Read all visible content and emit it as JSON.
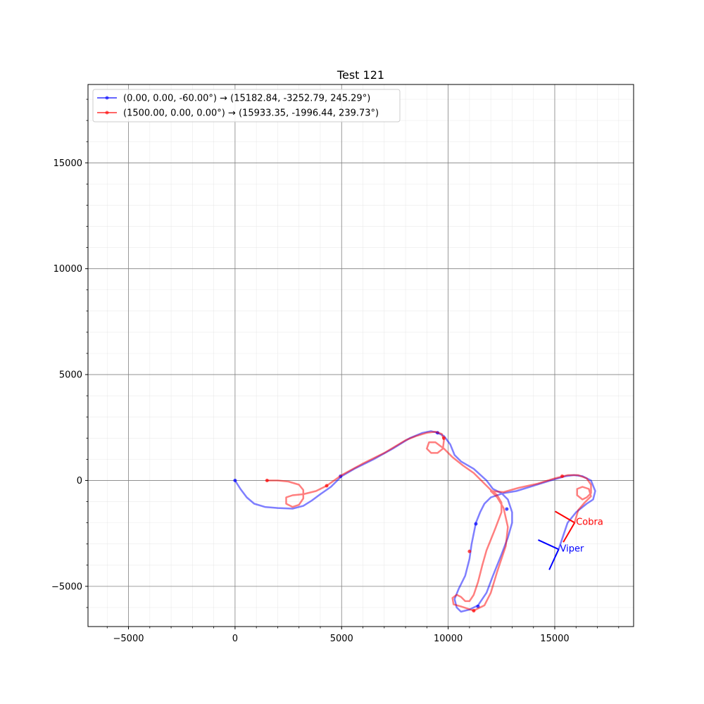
{
  "chart_data": {
    "type": "line",
    "title": "Test 121",
    "xlim": [
      -6900,
      18700
    ],
    "ylim": [
      -6900,
      18700
    ],
    "xticks": [
      -5000,
      0,
      5000,
      10000,
      15000
    ],
    "yticks": [
      -5000,
      0,
      5000,
      10000,
      15000
    ],
    "tick_labels": [
      "−5000",
      "0",
      "5000",
      "10000",
      "15000"
    ],
    "grid": true,
    "legend_placement": "top-left",
    "series": [
      {
        "name": "(0.00, 0.00, -60.00°) → (15182.84, -3252.79, 245.29°)",
        "color": "#0000ff",
        "points": [
          [
            0,
            0
          ],
          [
            250,
            -400
          ],
          [
            550,
            -800
          ],
          [
            900,
            -1100
          ],
          [
            1400,
            -1250
          ],
          [
            2000,
            -1300
          ],
          [
            2700,
            -1330
          ],
          [
            3200,
            -1200
          ],
          [
            3600,
            -950
          ],
          [
            4000,
            -650
          ],
          [
            4500,
            -300
          ],
          [
            5000,
            200
          ],
          [
            5600,
            550
          ],
          [
            6500,
            1000
          ],
          [
            7400,
            1500
          ],
          [
            8200,
            2000
          ],
          [
            8800,
            2250
          ],
          [
            9200,
            2330
          ],
          [
            9500,
            2250
          ],
          [
            9800,
            2100
          ],
          [
            10100,
            1700
          ],
          [
            10300,
            1200
          ],
          [
            10600,
            900
          ],
          [
            11200,
            550
          ],
          [
            11800,
            0
          ],
          [
            12100,
            -400
          ],
          [
            12500,
            -600
          ],
          [
            12800,
            -900
          ],
          [
            13000,
            -1500
          ],
          [
            13000,
            -2000
          ],
          [
            12800,
            -2700
          ],
          [
            12500,
            -3500
          ],
          [
            12100,
            -4500
          ],
          [
            11800,
            -5300
          ],
          [
            11400,
            -5900
          ],
          [
            11000,
            -6100
          ],
          [
            10600,
            -6200
          ],
          [
            10400,
            -6000
          ],
          [
            10300,
            -5600
          ],
          [
            10500,
            -5100
          ],
          [
            10800,
            -4500
          ],
          [
            11000,
            -3700
          ],
          [
            11100,
            -3000
          ],
          [
            11300,
            -2000
          ],
          [
            11500,
            -1500
          ],
          [
            11700,
            -1100
          ],
          [
            12000,
            -800
          ],
          [
            12600,
            -600
          ],
          [
            13200,
            -500
          ],
          [
            14000,
            -250
          ],
          [
            14800,
            0
          ],
          [
            15500,
            200
          ],
          [
            15900,
            250
          ],
          [
            16300,
            200
          ],
          [
            16700,
            0
          ],
          [
            16900,
            -500
          ],
          [
            16800,
            -900
          ],
          [
            16500,
            -1100
          ],
          [
            16000,
            -1500
          ],
          [
            15600,
            -2000
          ],
          [
            15400,
            -2600
          ],
          [
            15182.84,
            -3252.79
          ]
        ],
        "markers": [
          [
            0,
            0
          ],
          [
            4950,
            200
          ],
          [
            9500,
            2250
          ],
          [
            12750,
            -1350
          ],
          [
            11300,
            -2050
          ],
          [
            11400,
            -5950
          ]
        ]
      },
      {
        "name": "(1500.00, 0.00, 0.00°) → (15933.35, -1996.44, 239.73°)",
        "color": "#ff0000",
        "points": [
          [
            1500,
            0
          ],
          [
            2000,
            0
          ],
          [
            2500,
            -50
          ],
          [
            3000,
            -200
          ],
          [
            3200,
            -450
          ],
          [
            3200,
            -850
          ],
          [
            3000,
            -1150
          ],
          [
            2700,
            -1250
          ],
          [
            2400,
            -1100
          ],
          [
            2400,
            -800
          ],
          [
            2700,
            -700
          ],
          [
            3200,
            -650
          ],
          [
            3800,
            -500
          ],
          [
            4300,
            -250
          ],
          [
            5000,
            250
          ],
          [
            6000,
            800
          ],
          [
            7000,
            1300
          ],
          [
            8000,
            1900
          ],
          [
            8500,
            2100
          ],
          [
            9000,
            2250
          ],
          [
            9400,
            2300
          ],
          [
            9700,
            2200
          ],
          [
            9800,
            1900
          ],
          [
            9750,
            1500
          ],
          [
            9500,
            1300
          ],
          [
            9200,
            1300
          ],
          [
            9000,
            1500
          ],
          [
            9100,
            1800
          ],
          [
            9400,
            1800
          ],
          [
            9800,
            1500
          ],
          [
            10200,
            1100
          ],
          [
            10700,
            700
          ],
          [
            11200,
            350
          ],
          [
            11600,
            -50
          ],
          [
            12000,
            -450
          ],
          [
            12300,
            -700
          ],
          [
            12500,
            -1050
          ],
          [
            12500,
            -1500
          ],
          [
            12200,
            -2300
          ],
          [
            11800,
            -3300
          ],
          [
            11600,
            -4000
          ],
          [
            11400,
            -4800
          ],
          [
            11200,
            -5400
          ],
          [
            11000,
            -5700
          ],
          [
            10800,
            -5700
          ],
          [
            10600,
            -5500
          ],
          [
            10400,
            -5400
          ],
          [
            10200,
            -5550
          ],
          [
            10250,
            -5850
          ],
          [
            10600,
            -5950
          ],
          [
            10900,
            -6050
          ],
          [
            11200,
            -6150
          ],
          [
            11700,
            -5900
          ],
          [
            12000,
            -5300
          ],
          [
            12300,
            -4300
          ],
          [
            12700,
            -3100
          ],
          [
            12800,
            -2200
          ],
          [
            12600,
            -1300
          ],
          [
            12300,
            -800
          ],
          [
            12000,
            -500
          ],
          [
            12600,
            -550
          ],
          [
            13300,
            -350
          ],
          [
            14200,
            -150
          ],
          [
            15000,
            100
          ],
          [
            15600,
            250
          ],
          [
            16100,
            250
          ],
          [
            16500,
            100
          ],
          [
            16700,
            -200
          ],
          [
            16700,
            -600
          ],
          [
            16500,
            -800
          ],
          [
            16300,
            -900
          ],
          [
            16050,
            -700
          ],
          [
            16050,
            -400
          ],
          [
            16300,
            -300
          ],
          [
            16600,
            -400
          ],
          [
            16700,
            -750
          ],
          [
            16400,
            -1050
          ],
          [
            16100,
            -1400
          ],
          [
            15933.35,
            -1996.44
          ]
        ],
        "markers": [
          [
            1500,
            0
          ],
          [
            4300,
            -250
          ],
          [
            9800,
            2000
          ],
          [
            11000,
            -3350
          ],
          [
            11200,
            -6150
          ],
          [
            15350,
            200
          ]
        ]
      }
    ],
    "annotations": [
      {
        "label": "Cobra",
        "color": "#ff0000",
        "x": 15933.35,
        "y": -1996.44,
        "heading_deg": 239.73
      },
      {
        "label": "Viper",
        "color": "#0000ff",
        "x": 15182.84,
        "y": -3252.79,
        "heading_deg": 245.29
      }
    ]
  }
}
